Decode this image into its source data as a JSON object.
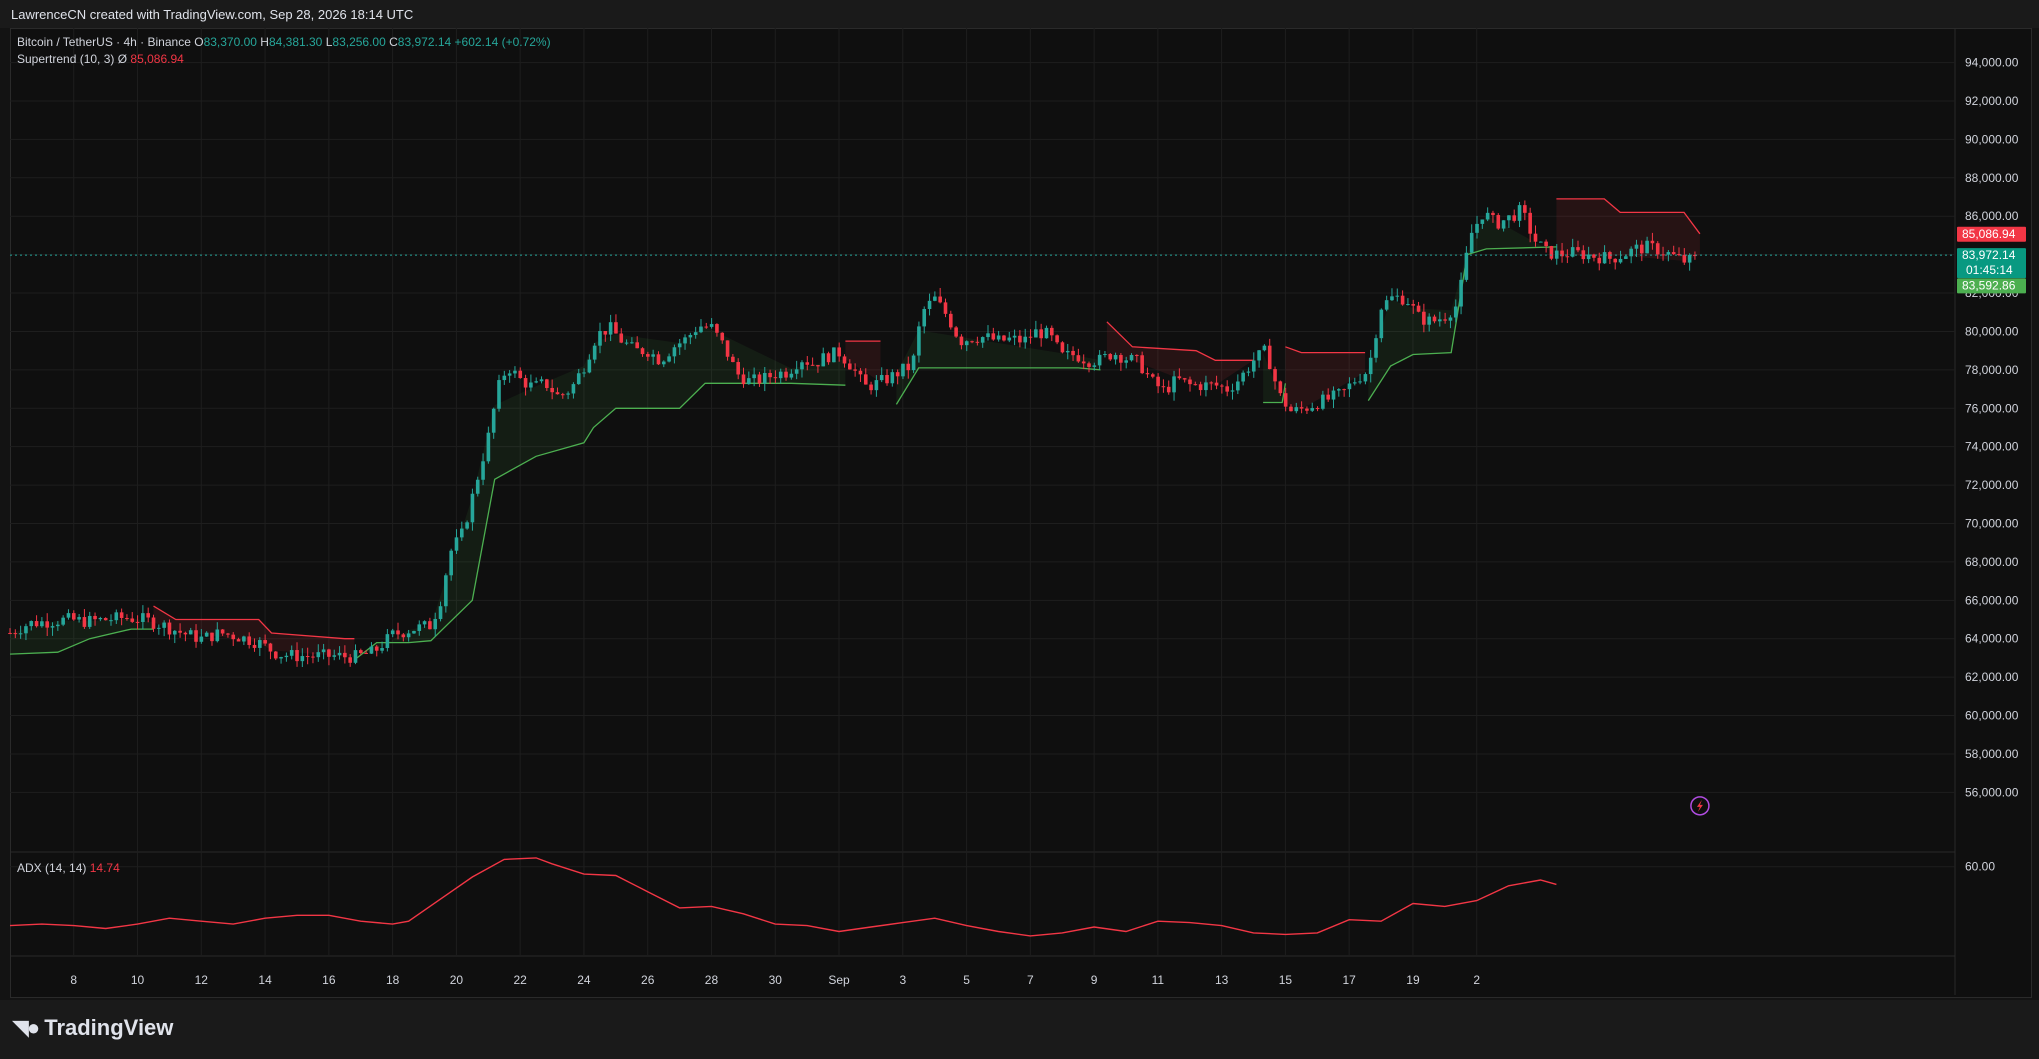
{
  "header": {
    "credit": "LawrenceCN created with TradingView.com, Sep 28, 2026 18:14 UTC"
  },
  "legend": {
    "symbol": "Bitcoin / TetherUS · 4h · Binance",
    "open_label": "O",
    "open": "83,370.00",
    "high_label": "H",
    "high": "84,381.30",
    "low_label": "L",
    "low": "83,256.00",
    "close_label": "C",
    "close": "83,972.14",
    "change": "+602.14 (+0.72%)",
    "supertrend_label": "Supertrend (10, 3)",
    "supertrend_icon": "Ø",
    "supertrend_value": "85,086.94",
    "adx_label": "ADX (14, 14)",
    "adx_value": "14.74"
  },
  "badges": {
    "supertrend_upper": "85,086.94",
    "last_price": "83,972.14",
    "countdown": "01:45:14",
    "supertrend_lower": "83,592.86"
  },
  "footer": {
    "brand": "TradingView",
    "brand_icon": "tradingview-logo-icon"
  },
  "colors": {
    "up": "#26a69a",
    "down": "#f23645",
    "st_up": "#4caf50",
    "st_down": "#f23645",
    "adx": "#f23645",
    "grid": "#1e1e1e"
  },
  "chart_data": {
    "type": "candlestick",
    "title": "Bitcoin / TetherUS · 4h · Binance",
    "price_ticks": [
      "94,000.00",
      "92,000.00",
      "90,000.00",
      "88,000.00",
      "86,000.00",
      "84,000.00",
      "82,000.00",
      "80,000.00",
      "78,000.00",
      "76,000.00",
      "74,000.00",
      "72,000.00",
      "70,000.00",
      "68,000.00",
      "66,000.00",
      "64,000.00",
      "62,000.00",
      "60,000.00",
      "58,000.00",
      "56,000.00"
    ],
    "price_tick_values": [
      94000,
      92000,
      90000,
      88000,
      86000,
      84000,
      82000,
      80000,
      78000,
      76000,
      74000,
      72000,
      70000,
      68000,
      66000,
      64000,
      62000,
      60000,
      58000,
      56000
    ],
    "ylim": [
      53000,
      95800
    ],
    "x_ticks": [
      "8",
      "10",
      "12",
      "14",
      "16",
      "18",
      "20",
      "22",
      "24",
      "26",
      "28",
      "30",
      "Sep",
      "3",
      "5",
      "7",
      "9",
      "11",
      "13",
      "15",
      "17",
      "19",
      "2"
    ],
    "x_tick_days": [
      2,
      4,
      6,
      8,
      10,
      12,
      14,
      16,
      18,
      20,
      22,
      24,
      26,
      28,
      30,
      32,
      34,
      36,
      38,
      40,
      42,
      44,
      46
    ],
    "xlim_days": [
      0,
      61
    ],
    "close_path": [
      [
        0.0,
        64300
      ],
      [
        0.6,
        64800
      ],
      [
        1.2,
        64900
      ],
      [
        1.8,
        65000
      ],
      [
        2.4,
        64900
      ],
      [
        3.0,
        65000
      ],
      [
        3.6,
        65100
      ],
      [
        4.2,
        65000
      ],
      [
        4.8,
        64700
      ],
      [
        5.4,
        64300
      ],
      [
        6.0,
        64000
      ],
      [
        6.6,
        64300
      ],
      [
        7.2,
        64100
      ],
      [
        7.8,
        63800
      ],
      [
        8.4,
        63200
      ],
      [
        9.0,
        63100
      ],
      [
        9.6,
        63100
      ],
      [
        10.2,
        63100
      ],
      [
        10.8,
        63050
      ],
      [
        11.4,
        63300
      ],
      [
        12.0,
        64200
      ],
      [
        12.6,
        64500
      ],
      [
        13.2,
        64700
      ],
      [
        13.5,
        66000
      ],
      [
        13.8,
        68500
      ],
      [
        14.2,
        69500
      ],
      [
        14.6,
        72000
      ],
      [
        15.0,
        74500
      ],
      [
        15.3,
        77000
      ],
      [
        15.6,
        78200
      ],
      [
        16.0,
        77500
      ],
      [
        16.4,
        77100
      ],
      [
        16.8,
        77300
      ],
      [
        17.2,
        76600
      ],
      [
        17.6,
        77000
      ],
      [
        18.0,
        78200
      ],
      [
        18.4,
        79800
      ],
      [
        18.8,
        80200
      ],
      [
        19.2,
        79500
      ],
      [
        19.6,
        79000
      ],
      [
        20.0,
        79000
      ],
      [
        20.4,
        78500
      ],
      [
        20.8,
        79200
      ],
      [
        21.2,
        79600
      ],
      [
        21.6,
        80300
      ],
      [
        22.0,
        80200
      ],
      [
        22.4,
        79200
      ],
      [
        22.8,
        77800
      ],
      [
        23.2,
        77400
      ],
      [
        23.6,
        77500
      ],
      [
        24.0,
        77800
      ],
      [
        24.4,
        77900
      ],
      [
        24.8,
        78600
      ],
      [
        25.2,
        78300
      ],
      [
        25.6,
        78700
      ],
      [
        26.0,
        78900
      ],
      [
        26.4,
        78200
      ],
      [
        26.8,
        77100
      ],
      [
        27.2,
        77300
      ],
      [
        27.6,
        77600
      ],
      [
        28.0,
        78000
      ],
      [
        28.3,
        78200
      ],
      [
        28.6,
        81000
      ],
      [
        29.0,
        81700
      ],
      [
        29.4,
        80800
      ],
      [
        29.8,
        79500
      ],
      [
        30.2,
        79700
      ],
      [
        30.6,
        79700
      ],
      [
        31.0,
        79500
      ],
      [
        31.4,
        79600
      ],
      [
        31.8,
        79500
      ],
      [
        32.2,
        80000
      ],
      [
        32.6,
        79800
      ],
      [
        33.0,
        78700
      ],
      [
        33.4,
        78800
      ],
      [
        33.8,
        78500
      ],
      [
        34.2,
        78500
      ],
      [
        34.6,
        78900
      ],
      [
        35.0,
        78600
      ],
      [
        35.4,
        78400
      ],
      [
        35.8,
        77400
      ],
      [
        36.2,
        76900
      ],
      [
        36.6,
        77500
      ],
      [
        37.0,
        77200
      ],
      [
        37.4,
        77200
      ],
      [
        37.8,
        77200
      ],
      [
        38.2,
        77000
      ],
      [
        38.6,
        77600
      ],
      [
        39.0,
        78500
      ],
      [
        39.4,
        79000
      ],
      [
        39.8,
        76700
      ],
      [
        40.2,
        75800
      ],
      [
        40.6,
        76000
      ],
      [
        41.0,
        76300
      ],
      [
        41.4,
        76500
      ],
      [
        41.8,
        76800
      ],
      [
        42.2,
        77500
      ],
      [
        42.6,
        78000
      ],
      [
        43.0,
        81300
      ],
      [
        43.4,
        81800
      ],
      [
        43.8,
        81700
      ],
      [
        44.2,
        80700
      ],
      [
        44.6,
        80500
      ],
      [
        45.0,
        80800
      ],
      [
        45.4,
        81400
      ],
      [
        45.8,
        85000
      ],
      [
        46.2,
        86200
      ],
      [
        46.6,
        85600
      ],
      [
        47.0,
        85900
      ],
      [
        47.4,
        86300
      ],
      [
        47.8,
        84800
      ],
      [
        48.2,
        84100
      ],
      [
        48.6,
        84000
      ],
      [
        49.0,
        84100
      ],
      [
        49.4,
        84000
      ],
      [
        49.8,
        83900
      ],
      [
        50.2,
        83800
      ],
      [
        50.6,
        84000
      ],
      [
        51.0,
        84300
      ],
      [
        51.4,
        84400
      ],
      [
        51.8,
        84200
      ],
      [
        52.2,
        83900
      ],
      [
        52.6,
        83600
      ],
      [
        52.9,
        83972
      ]
    ],
    "supertrend_up_segments": [
      [
        [
          0.0,
          63200
        ],
        [
          1.5,
          63300
        ],
        [
          2.5,
          64000
        ],
        [
          3.8,
          64500
        ],
        [
          4.5,
          64500
        ]
      ],
      [
        [
          10.8,
          62900
        ],
        [
          11.5,
          63800
        ],
        [
          12.5,
          63800
        ],
        [
          13.2,
          63900
        ],
        [
          14.5,
          66000
        ],
        [
          15.2,
          72300
        ],
        [
          16.5,
          73500
        ],
        [
          18.0,
          74200
        ],
        [
          18.3,
          75000
        ],
        [
          19.0,
          76000
        ],
        [
          21.0,
          76000
        ],
        [
          21.8,
          77300
        ],
        [
          24.5,
          77300
        ],
        [
          26.2,
          77200
        ]
      ],
      [
        [
          27.8,
          76200
        ],
        [
          28.5,
          78100
        ],
        [
          33.5,
          78100
        ],
        [
          34.2,
          78000
        ]
      ],
      [
        [
          39.3,
          76300
        ],
        [
          39.9,
          76300
        ],
        [
          40.0,
          77300
        ]
      ],
      [
        [
          42.6,
          76400
        ],
        [
          43.3,
          78200
        ],
        [
          44.0,
          78800
        ],
        [
          45.2,
          78900
        ],
        [
          45.7,
          84000
        ],
        [
          46.3,
          84300
        ],
        [
          48.5,
          84400
        ]
      ]
    ],
    "supertrend_down_segments": [
      [
        [
          4.5,
          65700
        ],
        [
          5.2,
          65000
        ],
        [
          7.8,
          65000
        ],
        [
          8.2,
          64300
        ],
        [
          10.5,
          64000
        ],
        [
          10.8,
          64000
        ]
      ],
      [
        [
          26.2,
          79500
        ],
        [
          27.3,
          79500
        ]
      ],
      [
        [
          34.4,
          80500
        ],
        [
          35.2,
          79200
        ],
        [
          37.2,
          79000
        ],
        [
          37.8,
          78500
        ],
        [
          39.0,
          78500
        ]
      ],
      [
        [
          40.0,
          79200
        ],
        [
          40.5,
          78900
        ],
        [
          42.5,
          78900
        ]
      ],
      [
        [
          48.5,
          86900
        ],
        [
          50.0,
          86900
        ],
        [
          50.5,
          86200
        ],
        [
          52.5,
          86200
        ],
        [
          53.0,
          85086
        ]
      ]
    ],
    "adx": {
      "name": "ADX (14, 14)",
      "ylim": [
        0,
        70
      ],
      "tick": "60.00",
      "tick_value": 60,
      "points": [
        [
          0.0,
          20
        ],
        [
          1.0,
          21
        ],
        [
          2.0,
          20
        ],
        [
          3.0,
          18
        ],
        [
          4.0,
          21
        ],
        [
          5.0,
          25
        ],
        [
          6.0,
          23
        ],
        [
          7.0,
          21
        ],
        [
          8.0,
          25
        ],
        [
          9.0,
          27
        ],
        [
          10.0,
          27
        ],
        [
          11.0,
          23
        ],
        [
          12.0,
          21
        ],
        [
          12.5,
          23
        ],
        [
          13.5,
          38
        ],
        [
          14.5,
          53
        ],
        [
          15.5,
          65
        ],
        [
          16.5,
          66
        ],
        [
          17.0,
          62
        ],
        [
          18.0,
          55
        ],
        [
          19.0,
          54
        ],
        [
          20.0,
          43
        ],
        [
          21.0,
          32
        ],
        [
          22.0,
          33
        ],
        [
          23.0,
          28
        ],
        [
          24.0,
          21
        ],
        [
          25.0,
          20
        ],
        [
          26.0,
          16
        ],
        [
          27.0,
          19
        ],
        [
          28.0,
          22
        ],
        [
          29.0,
          25
        ],
        [
          30.0,
          20
        ],
        [
          31.0,
          16
        ],
        [
          32.0,
          13
        ],
        [
          33.0,
          15
        ],
        [
          34.0,
          19
        ],
        [
          35.0,
          16
        ],
        [
          36.0,
          23
        ],
        [
          37.0,
          22
        ],
        [
          38.0,
          20
        ],
        [
          39.0,
          15
        ],
        [
          40.0,
          14
        ],
        [
          41.0,
          15
        ],
        [
          42.0,
          24
        ],
        [
          43.0,
          23
        ],
        [
          44.0,
          35
        ],
        [
          45.0,
          33
        ],
        [
          46.0,
          37
        ],
        [
          47.0,
          47
        ],
        [
          48.0,
          51
        ],
        [
          48.5,
          48
        ]
      ]
    }
  }
}
